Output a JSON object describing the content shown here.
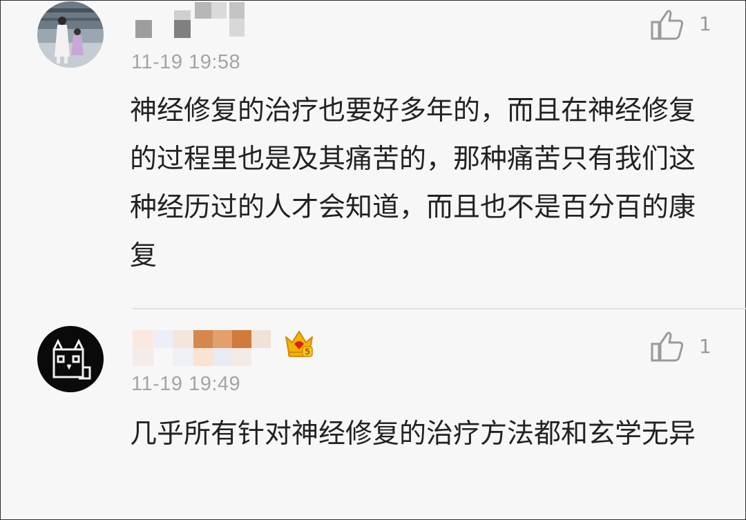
{
  "comments": [
    {
      "timestamp": "11-19 19:58",
      "text": "神经修复的治疗也要好多年的，而且在神经修复的过程里也是及其痛苦的，那种痛苦只有我们这种经历过的人才会知道，而且也不是百分百的康复",
      "likes": "1",
      "avatar_icon": "photo-avatar",
      "like_icon": "thumbs-up-icon"
    },
    {
      "timestamp": "11-19 19:49",
      "text": "几乎所有针对神经修复的治疗方法都和玄学无异",
      "likes": "1",
      "avatar_icon": "pixel-cat-avatar",
      "badge_icon": "crown-level-badge-icon",
      "badge_level": "5",
      "like_icon": "thumbs-up-icon"
    }
  ],
  "colors": {
    "background": "#f7f7f7",
    "text": "#222222",
    "meta": "#a4a4a4",
    "badge_gold": "#f4b400",
    "badge_red": "#e02020"
  }
}
